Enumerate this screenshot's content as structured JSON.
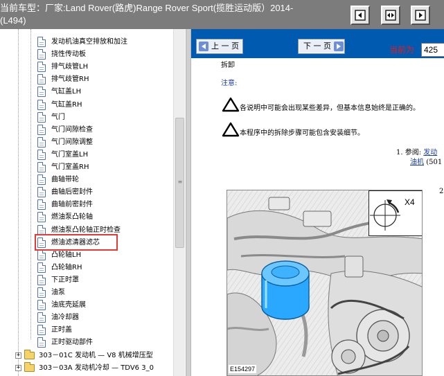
{
  "window": {
    "title": "当前车型：厂家:Land Rover(路虎)Range Rover Sport(揽胜运动版）2014-(L494)"
  },
  "toolbar": {
    "buttons": [
      {
        "icon": "collapse-left-icon"
      },
      {
        "icon": "split-view-icon"
      },
      {
        "icon": "collapse-right-icon"
      }
    ]
  },
  "tree": {
    "items": [
      {
        "label": "发动机油真空排放和加注"
      },
      {
        "label": "挠性传动板"
      },
      {
        "label": "排气歧管LH"
      },
      {
        "label": "排气歧管RH"
      },
      {
        "label": "气缸盖LH"
      },
      {
        "label": "气缸盖RH"
      },
      {
        "label": "气门"
      },
      {
        "label": "气门间隙检查"
      },
      {
        "label": "气门间隙调整"
      },
      {
        "label": "气门室盖LH"
      },
      {
        "label": "气门室盖RH"
      },
      {
        "label": "曲轴带轮"
      },
      {
        "label": "曲轴后密封件"
      },
      {
        "label": "曲轴前密封件"
      },
      {
        "label": "燃油泵凸轮轴"
      },
      {
        "label": "燃油泵凸轮轴正时检查"
      },
      {
        "label": "燃油滤清器滤芯",
        "selected": true
      },
      {
        "label": "凸轮轴LH"
      },
      {
        "label": "凸轮轴RH"
      },
      {
        "label": "下正时罩"
      },
      {
        "label": "油泵"
      },
      {
        "label": "油底壳延展"
      },
      {
        "label": "油冷却器"
      },
      {
        "label": "正时盖"
      },
      {
        "label": "正时驱动部件"
      }
    ],
    "folders": [
      {
        "label": "303－01C 发动机 — V8 机械增压型"
      },
      {
        "label": "303－03A 发动机冷却 — TDV6 3_0"
      }
    ]
  },
  "nav": {
    "prev_label": "上 一 页",
    "next_label": "下 一 页",
    "current_label": "当前为",
    "page_value": "425"
  },
  "document": {
    "heading": "拆卸",
    "note_label": "注意:",
    "warnings": [
      "各说明中可能会出现某些差异，但基本信息始终是正确的。",
      "本程序中的拆除步骤可能包含安装细节。"
    ],
    "step1_prefix": "1.  参阅:",
    "step1_link_a": "发动",
    "step1_link_b": "油机",
    "step1_suffix": "(501",
    "step2_number": "2",
    "figure": {
      "rotation_label": "X4",
      "code": "E154297",
      "highlight_color": "#2aa7ff"
    }
  },
  "colors": {
    "title_bar": "#7c7c7c",
    "nav_bar": "#005bb0",
    "selection_box": "#e53935",
    "current_label": "#e41b1b"
  }
}
